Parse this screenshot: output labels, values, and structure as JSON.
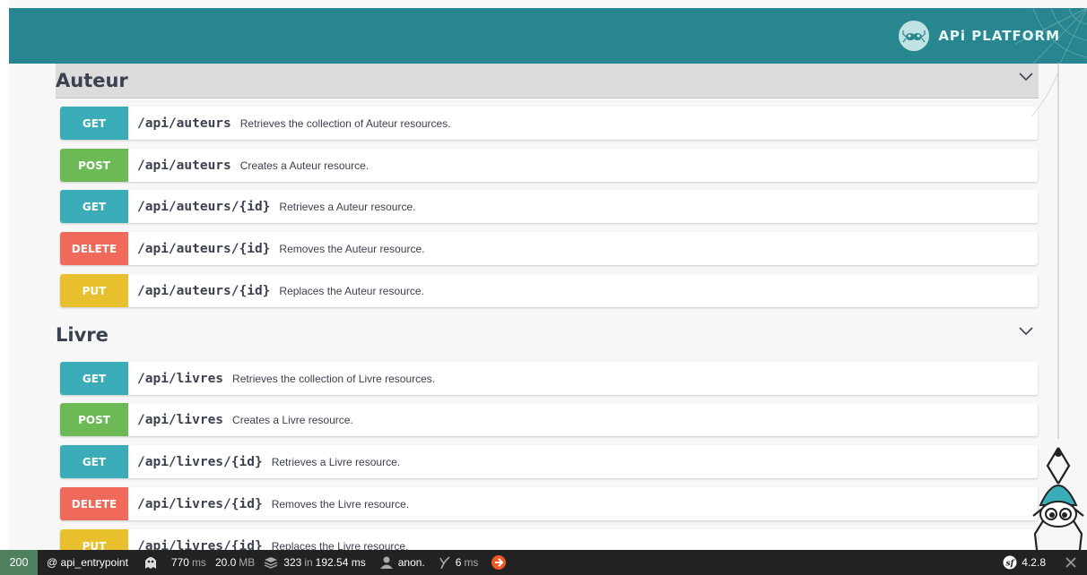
{
  "header": {
    "logo_text": "APi PLATFORM",
    "bg_color": "#288690"
  },
  "sections": [
    {
      "title": "Auteur",
      "operations": [
        {
          "method": "GET",
          "path": "/api/auteurs",
          "summary": "Retrieves the collection of Auteur resources."
        },
        {
          "method": "POST",
          "path": "/api/auteurs",
          "summary": "Creates a Auteur resource."
        },
        {
          "method": "GET",
          "path": "/api/auteurs/{id}",
          "summary": "Retrieves a Auteur resource."
        },
        {
          "method": "DELETE",
          "path": "/api/auteurs/{id}",
          "summary": "Removes the Auteur resource."
        },
        {
          "method": "PUT",
          "path": "/api/auteurs/{id}",
          "summary": "Replaces the Auteur resource."
        }
      ]
    },
    {
      "title": "Livre",
      "operations": [
        {
          "method": "GET",
          "path": "/api/livres",
          "summary": "Retrieves the collection of Livre resources."
        },
        {
          "method": "POST",
          "path": "/api/livres",
          "summary": "Creates a Livre resource."
        },
        {
          "method": "GET",
          "path": "/api/livres/{id}",
          "summary": "Retrieves a Livre resource."
        },
        {
          "method": "DELETE",
          "path": "/api/livres/{id}",
          "summary": "Removes the Livre resource."
        },
        {
          "method": "PUT",
          "path": "/api/livres/{id}",
          "summary": "Replaces the Livre resource."
        }
      ]
    }
  ],
  "method_colors": {
    "GET": "#3aadb9",
    "POST": "#6cba55",
    "DELETE": "#ef6a5a",
    "PUT": "#e8c02e"
  },
  "toolbar": {
    "status_code": "200",
    "route": "@ api_entrypoint",
    "time_value": "770",
    "time_unit": "ms",
    "memory_value": "20.0",
    "memory_unit": "MB",
    "db_queries": "323",
    "db_in": "in",
    "db_time": "192.54 ms",
    "user": "anon.",
    "twig_value": "6",
    "twig_unit": "ms",
    "symfony_version": "4.2.8"
  }
}
